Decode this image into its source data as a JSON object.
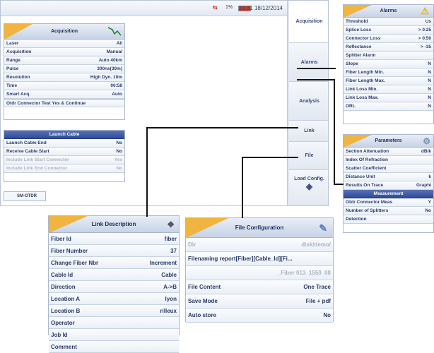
{
  "statusbar": {
    "battery_pct": "1%",
    "time": "10:31 18/12/2014"
  },
  "tabs": [
    "Acquisition",
    "Alarms",
    "Analysis",
    "Link",
    "File",
    "Load Config."
  ],
  "acquisition": {
    "title": "Acquisition",
    "rows": [
      {
        "k": "Laser",
        "v": "All"
      },
      {
        "k": "Acquisition",
        "v": "Manual"
      },
      {
        "k": "Range",
        "v": "Auto 40km"
      },
      {
        "k": "Pulse",
        "v": "300ns(30m)"
      },
      {
        "k": "Resolution",
        "v": "High Dyn. 10m"
      },
      {
        "k": "Time",
        "v": "00:58"
      },
      {
        "k": "Smart Acq.",
        "v": "Auto"
      }
    ],
    "otdr_row": "Otdr Connector Test  Yes & Continue"
  },
  "launch": {
    "title": "Launch Cable",
    "rows": [
      {
        "k": "Launch Cable End",
        "v": "No"
      },
      {
        "k": "Receive Cable Start",
        "v": "No"
      },
      {
        "k": "Include Link Start Connector",
        "v": "Yes"
      },
      {
        "k": "Include Link End Connector",
        "v": "No"
      }
    ]
  },
  "bottom_label": "SM-OTDR",
  "alarms": {
    "title": "Alarms",
    "rows": [
      {
        "k": "Threshold",
        "v": "Us"
      },
      {
        "k": "Splice Loss",
        "v": "> 0.25"
      },
      {
        "k": "Connector Loss",
        "v": "> 0.50"
      },
      {
        "k": "Reflectance",
        "v": "> -35"
      },
      {
        "k": "Splitter Alarm",
        "v": ""
      },
      {
        "k": "Slope",
        "v": "N"
      },
      {
        "k": "Fiber Length Min.",
        "v": "N"
      },
      {
        "k": "Fiber Length Max.",
        "v": "N"
      },
      {
        "k": "Link Loss Min.",
        "v": "N"
      },
      {
        "k": "Link Loss Max.",
        "v": "N"
      },
      {
        "k": "ORL",
        "v": "N"
      }
    ]
  },
  "parameters": {
    "title": "Parameters",
    "rows": [
      {
        "k": "Section Attenuation",
        "v": "dB/k"
      },
      {
        "k": "Index Of Refraction",
        "v": ""
      },
      {
        "k": "Scatter Coefficient",
        "v": ""
      },
      {
        "k": "Distance Unit",
        "v": "k"
      },
      {
        "k": "Results On Trace",
        "v": "Graphi"
      }
    ],
    "measurement_title": "Measurement",
    "meas_rows": [
      {
        "k": "Otdr Connector Meas",
        "v": "Y"
      },
      {
        "k": "Number of Splitters",
        "v": "No"
      },
      {
        "k": "Detection",
        "v": ""
      }
    ]
  },
  "link": {
    "title": "Link Description",
    "rows": [
      {
        "k": "Fiber Id",
        "v": "fiber"
      },
      {
        "k": "Fiber Number",
        "v": "37"
      },
      {
        "k": "Change Fiber Nbr",
        "v": "Increment"
      },
      {
        "k": "Cable Id",
        "v": "Cable"
      },
      {
        "k": "Direction",
        "v": "A->B"
      },
      {
        "k": "Location A",
        "v": "lyon"
      },
      {
        "k": "Location B",
        "v": "rilleux"
      },
      {
        "k": "Operator",
        "v": ""
      },
      {
        "k": "Job Id",
        "v": ""
      },
      {
        "k": "Comment",
        "v": ""
      }
    ]
  },
  "file": {
    "title": "File Configuration",
    "dir_label": "Dir",
    "dir_value": "disk/demo/",
    "filenaming": "Filenaming  report[Fiber][Cable_Id][Fi...",
    "filenaming_value": "_Fiber 013_1550_08",
    "rows": [
      {
        "k": "File Content",
        "v": "One Trace"
      },
      {
        "k": "Save Mode",
        "v": "File + pdf"
      },
      {
        "k": "Auto store",
        "v": "No"
      }
    ]
  }
}
